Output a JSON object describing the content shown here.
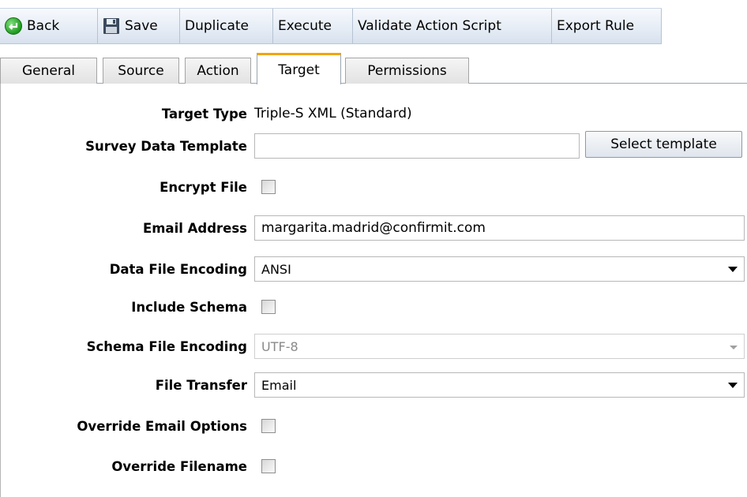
{
  "toolbar": {
    "back_label": "Back",
    "save_label": "Save",
    "duplicate_label": "Duplicate",
    "execute_label": "Execute",
    "validate_label": "Validate Action Script",
    "export_label": "Export Rule"
  },
  "tabs": [
    {
      "label": "General"
    },
    {
      "label": "Source"
    },
    {
      "label": "Action"
    },
    {
      "label": "Target"
    },
    {
      "label": "Permissions"
    }
  ],
  "form": {
    "target_type": {
      "label": "Target Type",
      "value": "Triple-S XML (Standard)"
    },
    "survey_template": {
      "label": "Survey Data Template",
      "value": "",
      "button_label": "Select template"
    },
    "encrypt_file": {
      "label": "Encrypt File",
      "checked": false
    },
    "email_address": {
      "label": "Email Address",
      "value": "margarita.madrid@confirmit.com"
    },
    "data_file_encoding": {
      "label": "Data File Encoding",
      "value": "ANSI"
    },
    "include_schema": {
      "label": "Include Schema",
      "checked": false
    },
    "schema_file_encoding": {
      "label": "Schema File Encoding",
      "value": "UTF-8",
      "disabled": true
    },
    "file_transfer": {
      "label": "File Transfer",
      "value": "Email"
    },
    "override_email_options": {
      "label": "Override Email Options",
      "checked": false
    },
    "override_filename": {
      "label": "Override Filename",
      "checked": false
    }
  },
  "colors": {
    "active_tab_accent": "#f0a500",
    "toolbar_gradient_top": "#f7f9fc",
    "toolbar_gradient_bottom": "#d7e1ee"
  }
}
